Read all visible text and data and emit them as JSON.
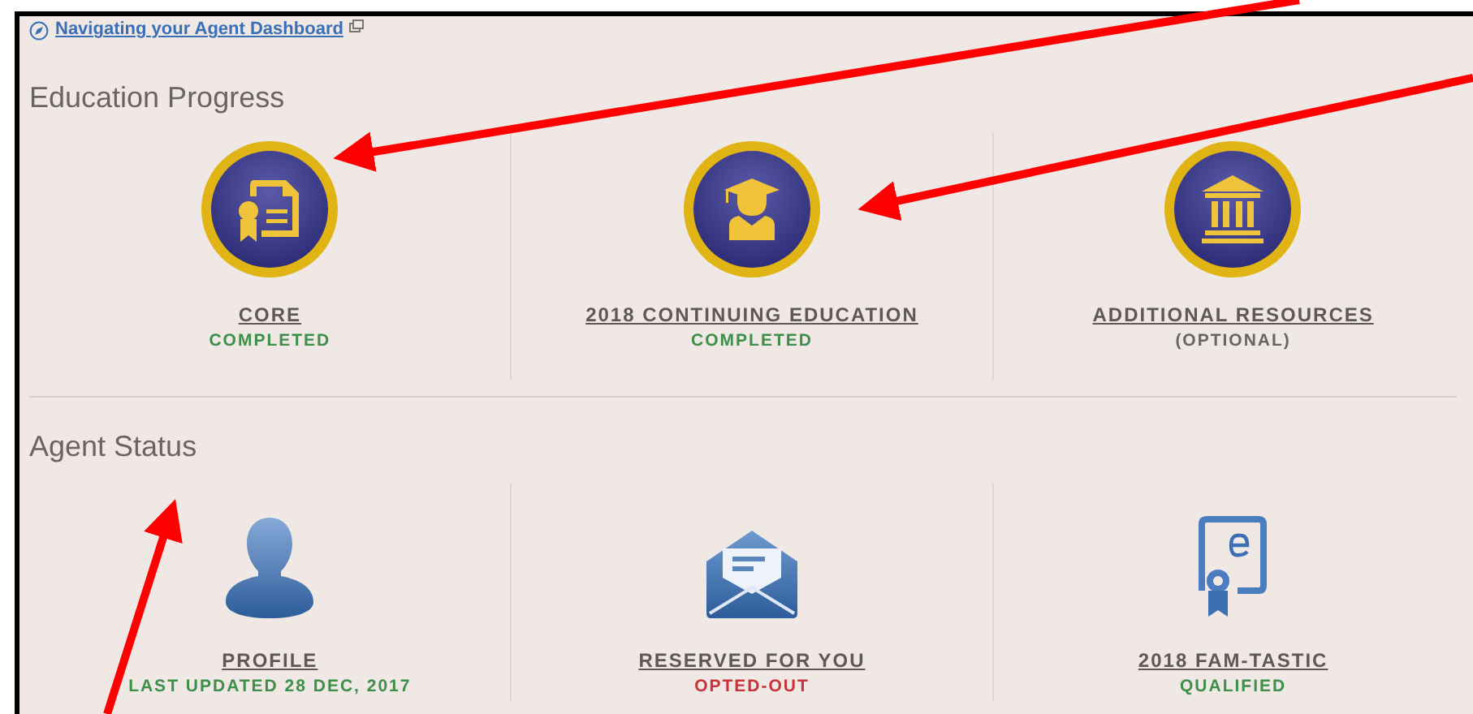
{
  "help_link": {
    "label": "Navigating your Agent Dashboard"
  },
  "sections": [
    {
      "title": "Education Progress",
      "items": [
        {
          "title": "CORE",
          "status": "COMPLETED",
          "color": "#3d8f4a"
        },
        {
          "title": "2018 CONTINUING EDUCATION",
          "status": "COMPLETED",
          "color": "#3d8f4a"
        },
        {
          "title": "ADDITIONAL RESOURCES",
          "status": "(OPTIONAL)",
          "color": "#666666"
        }
      ]
    },
    {
      "title": "Agent Status",
      "items": [
        {
          "title": "PROFILE",
          "status": "LAST UPDATED 28 DEC, 2017",
          "color": "#3d8f4a"
        },
        {
          "title": "RESERVED FOR YOU",
          "status": "OPTED-OUT",
          "color": "#c8323c"
        },
        {
          "title": "2018 FAM-TASTIC",
          "status": "QUALIFIED",
          "color": "#3d8f4a"
        }
      ]
    }
  ]
}
